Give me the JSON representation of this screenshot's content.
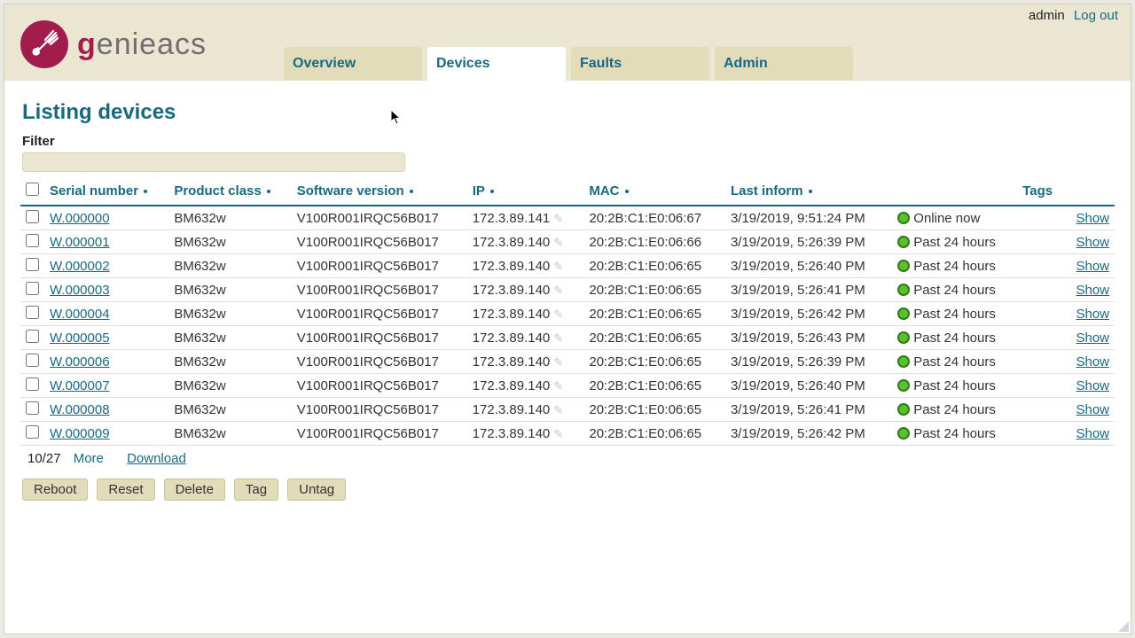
{
  "user": {
    "name": "admin",
    "logout": "Log out"
  },
  "brand": {
    "name": "genieacs"
  },
  "tabs": [
    {
      "id": "overview",
      "label": "Overview",
      "active": false
    },
    {
      "id": "devices",
      "label": "Devices",
      "active": true
    },
    {
      "id": "faults",
      "label": "Faults",
      "active": false
    },
    {
      "id": "admin",
      "label": "Admin",
      "active": false
    }
  ],
  "page": {
    "title": "Listing devices",
    "filter_label": "Filter",
    "filter_value": ""
  },
  "columns": {
    "serial": "Serial number",
    "product": "Product class",
    "software": "Software version",
    "ip": "IP",
    "mac": "MAC",
    "lastinform": "Last inform",
    "tags": "Tags",
    "show": "Show"
  },
  "status_labels": {
    "online": "Online now",
    "day": "Past 24 hours"
  },
  "rows": [
    {
      "serial": "W.000000",
      "product": "BM632w",
      "software": "V100R001IRQC56B017",
      "ip": "172.3.89.141",
      "mac": "20:2B:C1:E0:06:67",
      "lastinform": "3/19/2019, 9:51:24 PM",
      "status": "online"
    },
    {
      "serial": "W.000001",
      "product": "BM632w",
      "software": "V100R001IRQC56B017",
      "ip": "172.3.89.140",
      "mac": "20:2B:C1:E0:06:66",
      "lastinform": "3/19/2019, 5:26:39 PM",
      "status": "day"
    },
    {
      "serial": "W.000002",
      "product": "BM632w",
      "software": "V100R001IRQC56B017",
      "ip": "172.3.89.140",
      "mac": "20:2B:C1:E0:06:65",
      "lastinform": "3/19/2019, 5:26:40 PM",
      "status": "day"
    },
    {
      "serial": "W.000003",
      "product": "BM632w",
      "software": "V100R001IRQC56B017",
      "ip": "172.3.89.140",
      "mac": "20:2B:C1:E0:06:65",
      "lastinform": "3/19/2019, 5:26:41 PM",
      "status": "day"
    },
    {
      "serial": "W.000004",
      "product": "BM632w",
      "software": "V100R001IRQC56B017",
      "ip": "172.3.89.140",
      "mac": "20:2B:C1:E0:06:65",
      "lastinform": "3/19/2019, 5:26:42 PM",
      "status": "day"
    },
    {
      "serial": "W.000005",
      "product": "BM632w",
      "software": "V100R001IRQC56B017",
      "ip": "172.3.89.140",
      "mac": "20:2B:C1:E0:06:65",
      "lastinform": "3/19/2019, 5:26:43 PM",
      "status": "day"
    },
    {
      "serial": "W.000006",
      "product": "BM632w",
      "software": "V100R001IRQC56B017",
      "ip": "172.3.89.140",
      "mac": "20:2B:C1:E0:06:65",
      "lastinform": "3/19/2019, 5:26:39 PM",
      "status": "day"
    },
    {
      "serial": "W.000007",
      "product": "BM632w",
      "software": "V100R001IRQC56B017",
      "ip": "172.3.89.140",
      "mac": "20:2B:C1:E0:06:65",
      "lastinform": "3/19/2019, 5:26:40 PM",
      "status": "day"
    },
    {
      "serial": "W.000008",
      "product": "BM632w",
      "software": "V100R001IRQC56B017",
      "ip": "172.3.89.140",
      "mac": "20:2B:C1:E0:06:65",
      "lastinform": "3/19/2019, 5:26:41 PM",
      "status": "day"
    },
    {
      "serial": "W.000009",
      "product": "BM632w",
      "software": "V100R001IRQC56B017",
      "ip": "172.3.89.140",
      "mac": "20:2B:C1:E0:06:65",
      "lastinform": "3/19/2019, 5:26:42 PM",
      "status": "day"
    }
  ],
  "pager": {
    "count": "10/27",
    "more": "More",
    "download": "Download"
  },
  "actions": {
    "reboot": "Reboot",
    "reset": "Reset",
    "delete": "Delete",
    "tag": "Tag",
    "untag": "Untag"
  }
}
